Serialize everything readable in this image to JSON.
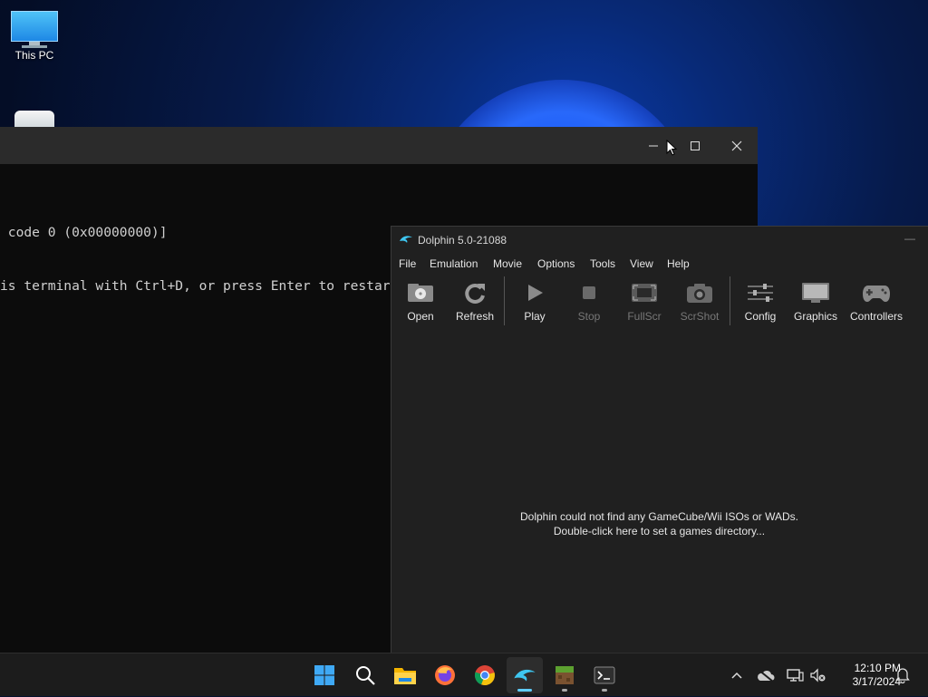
{
  "desktop": {
    "icons": [
      {
        "label": "This PC",
        "icon": "monitor-icon"
      },
      {
        "label": "",
        "icon": "recycle-bin-icon"
      }
    ]
  },
  "terminal": {
    "lines": [
      " code 0 (0x00000000)]",
      "is terminal with Ctrl+D, or press Enter to restart."
    ],
    "buttons": {
      "minimize": "minimize-icon",
      "maximize": "maximize-icon",
      "close": "close-icon"
    }
  },
  "dolphin": {
    "title": "Dolphin 5.0-21088",
    "menu": [
      "File",
      "Emulation",
      "Movie",
      "Options",
      "Tools",
      "View",
      "Help"
    ],
    "toolbar": [
      {
        "label": "Open",
        "icon": "open-disc-icon",
        "enabled": true
      },
      {
        "label": "Refresh",
        "icon": "refresh-icon",
        "enabled": true
      },
      {
        "label": "Play",
        "icon": "play-icon",
        "enabled": true
      },
      {
        "label": "Stop",
        "icon": "stop-icon",
        "enabled": false
      },
      {
        "label": "FullScr",
        "icon": "fullscreen-icon",
        "enabled": false
      },
      {
        "label": "ScrShot",
        "icon": "camera-icon",
        "enabled": false
      },
      {
        "label": "Config",
        "icon": "sliders-icon",
        "enabled": true
      },
      {
        "label": "Graphics",
        "icon": "monitor-icon",
        "enabled": true
      },
      {
        "label": "Controllers",
        "icon": "gamepad-icon",
        "enabled": true
      }
    ],
    "empty_message": [
      "Dolphin could not find any GameCube/Wii ISOs or WADs.",
      "Double-click here to set a games directory..."
    ]
  },
  "taskbar": {
    "apps": [
      {
        "name": "Start",
        "icon": "windows-start-icon"
      },
      {
        "name": "Search",
        "icon": "search-icon"
      },
      {
        "name": "File Explorer",
        "icon": "folder-icon"
      },
      {
        "name": "Firefox",
        "icon": "firefox-icon"
      },
      {
        "name": "Chrome",
        "icon": "chrome-icon"
      },
      {
        "name": "Dolphin",
        "icon": "dolphin-icon"
      },
      {
        "name": "Minecraft",
        "icon": "minecraft-icon"
      },
      {
        "name": "Terminal",
        "icon": "terminal-icon"
      }
    ],
    "tray": {
      "time": "12:10 PM",
      "date": "3/17/2024"
    },
    "colors": {
      "accent": "#60cdff"
    }
  }
}
